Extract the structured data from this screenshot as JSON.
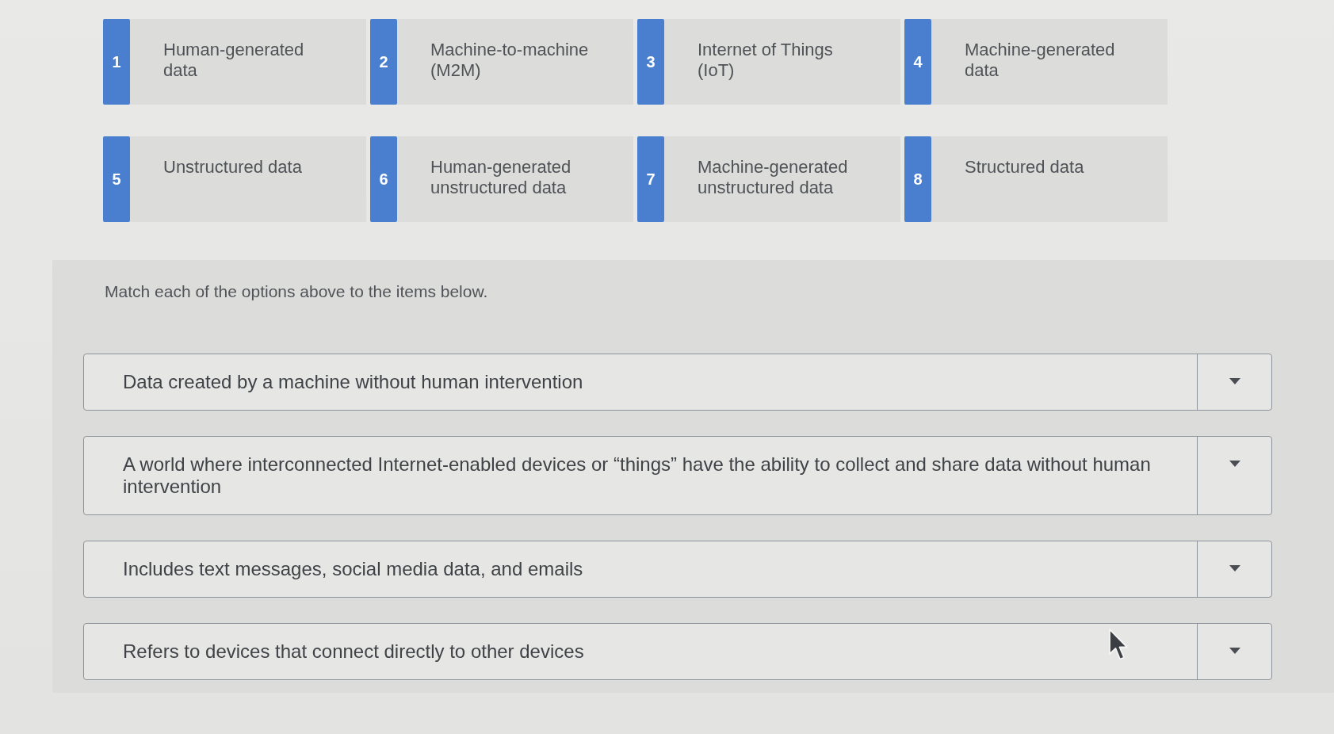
{
  "options": [
    {
      "number": "1",
      "label": "Human-generated data"
    },
    {
      "number": "2",
      "label": "Machine-to-machine (M2M)"
    },
    {
      "number": "3",
      "label": "Internet of Things (IoT)"
    },
    {
      "number": "4",
      "label": "Machine-generated data"
    },
    {
      "number": "5",
      "label": "Unstructured data"
    },
    {
      "number": "6",
      "label": "Human-generated unstructured data"
    },
    {
      "number": "7",
      "label": "Machine-generated unstructured data"
    },
    {
      "number": "8",
      "label": "Structured data"
    }
  ],
  "instruction": "Match each of the options above to the items below.",
  "items": [
    {
      "text": "Data created by a machine without human intervention"
    },
    {
      "text": "A world where interconnected Internet-enabled devices or “things” have the ability to collect and share data without human intervention"
    },
    {
      "text": "Includes text messages, social media data, and emails"
    },
    {
      "text": "Refers to devices that connect directly to other devices"
    }
  ]
}
